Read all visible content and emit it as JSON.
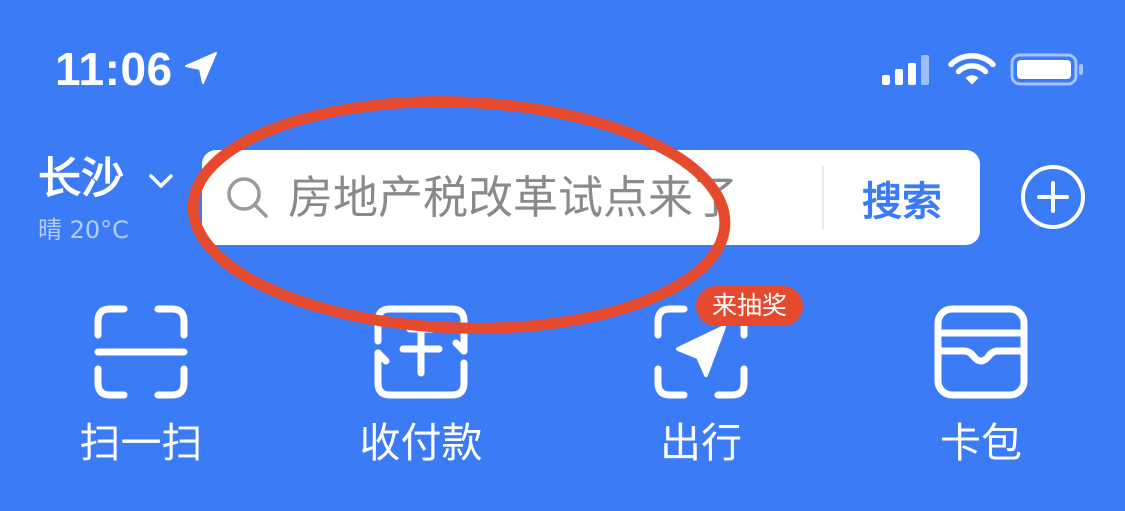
{
  "status_bar": {
    "time": "11:06",
    "icons": {
      "location": "location-arrow-icon",
      "signal": "signal-icon",
      "wifi": "wifi-icon",
      "battery": "battery-icon"
    }
  },
  "location": {
    "city": "长沙",
    "weather": "晴 20°C",
    "icon": "chevron-down-icon"
  },
  "search": {
    "placeholder": "房地产税改革试点来了",
    "button_label": "搜索",
    "icon": "search-icon"
  },
  "header_actions": {
    "add_icon": "plus-circle-icon"
  },
  "actions": [
    {
      "label": "扫一扫",
      "icon": "scan-icon"
    },
    {
      "label": "收付款",
      "icon": "pay-receive-icon"
    },
    {
      "label": "出行",
      "icon": "travel-icon",
      "badge": "来抽奖"
    },
    {
      "label": "卡包",
      "icon": "card-wallet-icon"
    }
  ],
  "colors": {
    "background": "#3b7bf6",
    "accent": "#3b7bf6",
    "placeholder_text": "#8a8a8a",
    "badge": "#e64a2e",
    "annotation": "#e64a2e"
  }
}
